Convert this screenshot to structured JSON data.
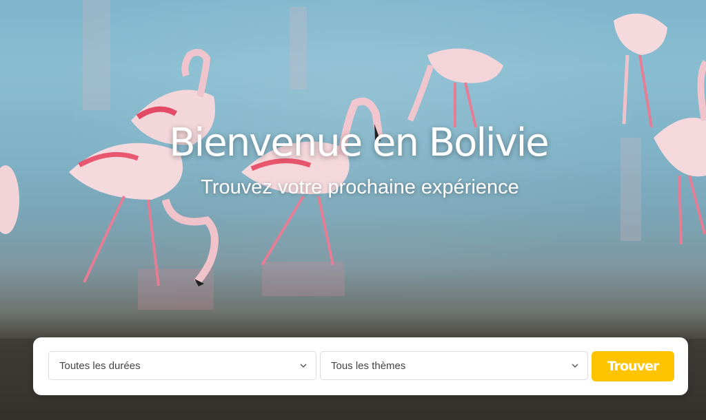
{
  "hero": {
    "title": "Bienvenue en Bolivie",
    "subtitle": "Trouvez votre prochaine expérience"
  },
  "search": {
    "duration": {
      "selected": "Toutes les durées",
      "icon": "chevron-down-icon"
    },
    "theme": {
      "selected": "Tous les thèmes",
      "icon": "chevron-down-icon"
    },
    "submit_label": "Trouver"
  },
  "colors": {
    "accent": "#ffc400",
    "water": "#85b9ce",
    "flamingo": "#f4c4cc"
  }
}
